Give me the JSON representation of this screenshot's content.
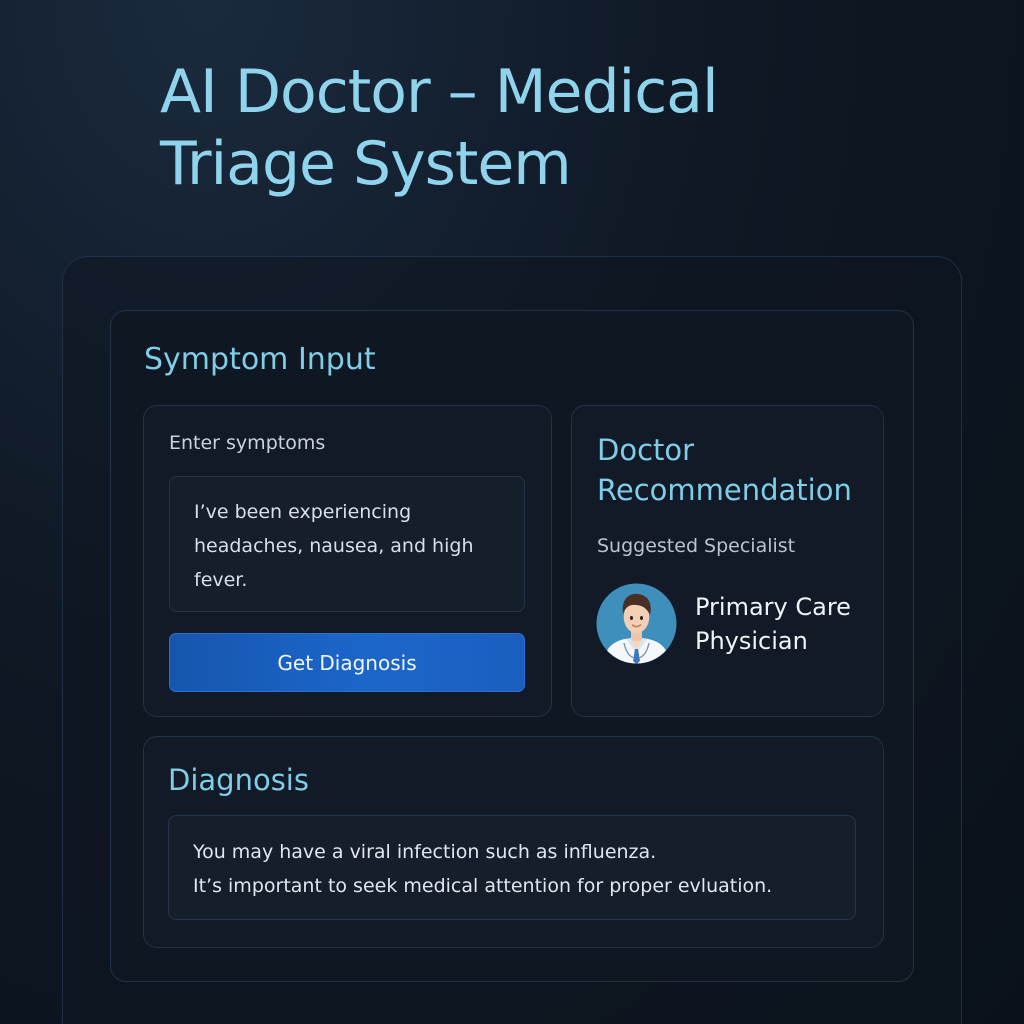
{
  "header": {
    "title": "AI Doctor – Medical Triage System"
  },
  "symptom_panel": {
    "heading": "Symptom Input",
    "field_label": "Enter symptoms",
    "symptoms_value": "I’ve been experiencing headaches, nausea, and high fever.",
    "button_label": "Get Diagnosis"
  },
  "doctor_panel": {
    "heading": "Doctor Recommendation",
    "specialist_label": "Suggested Specialist",
    "specialist_name": "Primary Care Physician",
    "avatar_icon": "doctor-avatar-icon"
  },
  "diagnosis_panel": {
    "heading": "Diagnosis",
    "lines": [
      "You may have a viral infection such as influenza.",
      "It’s important to seek medical attention for proper evluation."
    ]
  },
  "colors": {
    "background": "#0f1824",
    "accent_text": "#7fcde6",
    "button": "#1c66c9",
    "card_border": "#223247"
  }
}
